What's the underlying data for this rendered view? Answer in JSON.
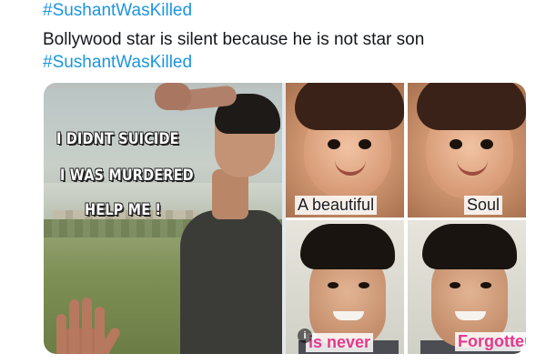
{
  "tweet": {
    "lines": [
      {
        "text": "#SushantWasKilled",
        "kind": "hashtag"
      },
      {
        "text": "Bollywood star is silent because he is not star son",
        "kind": "text"
      },
      {
        "text": "#SushantWasKilled",
        "kind": "hashtag"
      }
    ],
    "colors": {
      "hashtag": "#1b95e0",
      "text": "#14171a"
    }
  },
  "media": {
    "left_image": {
      "overlay_lines": [
        "I DIDNT SUICIDE",
        "I WAS MURDERED",
        "HELP ME !"
      ]
    },
    "right_collage": {
      "captions": [
        "A beautiful",
        "Soul",
        "is never",
        "Forgotten"
      ],
      "caption_colors": {
        "dark": "#1a1a1a",
        "pink": "#e43a8e"
      }
    },
    "info_icon": "info-icon"
  }
}
